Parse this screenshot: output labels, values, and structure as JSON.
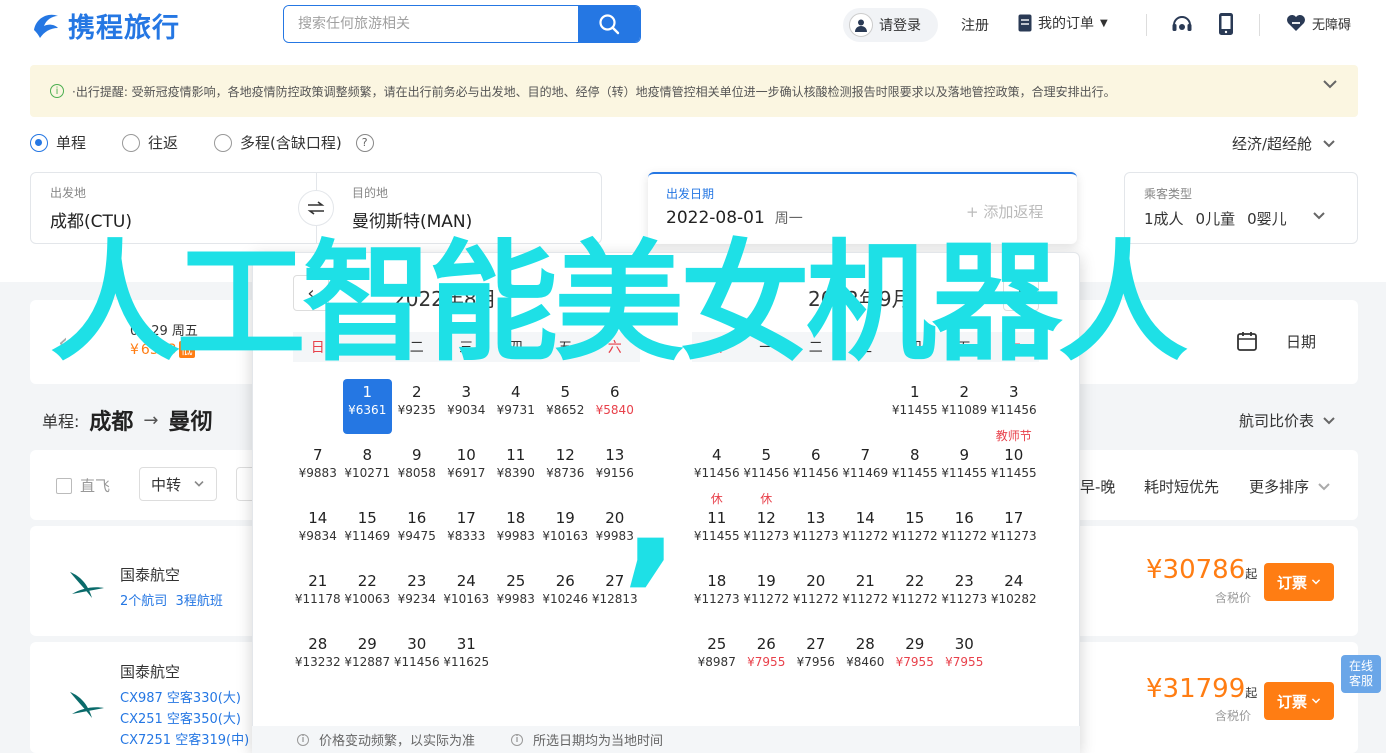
{
  "header": {
    "logo_text": "携程旅行",
    "search_placeholder": "搜索任何旅游相关",
    "login_label": "请登录",
    "register_label": "注册",
    "orders_label": "我的订单",
    "accessibility_label": "无障碍"
  },
  "notice": {
    "text": "·出行提醒: 受新冠疫情影响，各地疫情防控政策调整频繁，请在出行前务必与出发地、目的地、经停（转）地疫情管控相关单位进一步确认核酸检测报告时限要求以及落地管控政策，合理安排出行。"
  },
  "trip_types": [
    "单程",
    "往返",
    "多程(含缺口程)"
  ],
  "cabin_class": "经济/超经舱",
  "search_form": {
    "origin_label": "出发地",
    "origin_value": "成都(CTU)",
    "dest_label": "目的地",
    "dest_value": "曼彻斯特(MAN)",
    "date_label": "出发日期",
    "date_value": "2022-08-01",
    "date_weekday": "周一",
    "add_return": "+ 添加返程",
    "pax_label": "乘客类型",
    "pax_adult": "1成人",
    "pax_child": "0儿童",
    "pax_infant": "0婴儿"
  },
  "behind": {
    "date_strip_date": "07-29 周五",
    "date_strip_price": "6543",
    "date_strip_low": "低",
    "right_label": "日期",
    "route_prefix": "单程:",
    "route_from": "成都",
    "route_to": "曼彻",
    "compare_label": "航司比价表",
    "filter_direct": "直飞",
    "filter_transfer": "中转",
    "sort_early_late": "早-晚",
    "sort_shortest": "耗时短优先",
    "sort_more": "更多排序"
  },
  "flights": [
    {
      "airline": "国泰航空",
      "details": [
        "2个航司",
        "3程航班"
      ],
      "price": "¥30786",
      "price_suffix": "起",
      "tax_note": "含税价",
      "order_label": "订票"
    },
    {
      "airline": "国泰航空",
      "details": [
        "CX987 空客330(大)",
        "CX251 空客350(大)",
        "CX7251 空客319(中)"
      ],
      "price": "¥31799",
      "price_suffix": "起",
      "tax_note": "含税价",
      "order_label": "订票"
    }
  ],
  "calendar": {
    "left_title": "2022年8月",
    "right_title": "2022年9月",
    "weekdays": [
      "日",
      "一",
      "二",
      "三",
      "四",
      "五",
      "六"
    ],
    "left_days": [
      {
        "d": "1",
        "p": "¥6361",
        "sel": true
      },
      {
        "d": "2",
        "p": "¥9235"
      },
      {
        "d": "3",
        "p": "¥9034"
      },
      {
        "d": "4",
        "p": "¥9731"
      },
      {
        "d": "5",
        "p": "¥8652"
      },
      {
        "d": "6",
        "p": "¥5840",
        "red": true
      },
      {
        "d": "7",
        "p": "¥9883"
      },
      {
        "d": "8",
        "p": "¥10271"
      },
      {
        "d": "9",
        "p": "¥8058"
      },
      {
        "d": "10",
        "p": "¥6917"
      },
      {
        "d": "11",
        "p": "¥8390"
      },
      {
        "d": "12",
        "p": "¥8736"
      },
      {
        "d": "13",
        "p": "¥9156"
      },
      {
        "d": "14",
        "p": "¥9834"
      },
      {
        "d": "15",
        "p": "¥11469"
      },
      {
        "d": "16",
        "p": "¥9475"
      },
      {
        "d": "17",
        "p": "¥8333"
      },
      {
        "d": "18",
        "p": "¥9983"
      },
      {
        "d": "19",
        "p": "¥10163"
      },
      {
        "d": "20",
        "p": "¥9983"
      },
      {
        "d": "21",
        "p": "¥11178"
      },
      {
        "d": "22",
        "p": "¥10063"
      },
      {
        "d": "23",
        "p": "¥9234"
      },
      {
        "d": "24",
        "p": "¥10163"
      },
      {
        "d": "25",
        "p": "¥9983"
      },
      {
        "d": "26",
        "p": "¥10246"
      },
      {
        "d": "27",
        "p": "¥12813"
      },
      {
        "d": "28",
        "p": "¥13232"
      },
      {
        "d": "29",
        "p": "¥12887"
      },
      {
        "d": "30",
        "p": "¥11456"
      },
      {
        "d": "31",
        "p": "¥11625"
      }
    ],
    "right_days": [
      {
        "d": "1",
        "p": "¥11455"
      },
      {
        "d": "2",
        "p": "¥11089"
      },
      {
        "d": "3",
        "p": "¥11456"
      },
      {
        "d": "4",
        "p": "¥11456"
      },
      {
        "d": "5",
        "p": "¥11456"
      },
      {
        "d": "6",
        "p": "¥11456"
      },
      {
        "d": "7",
        "p": "¥11469"
      },
      {
        "d": "8",
        "p": "¥11455"
      },
      {
        "d": "9",
        "p": "¥11455"
      },
      {
        "d": "10",
        "p": "¥11455",
        "tag": "教师节"
      },
      {
        "d": "11",
        "p": "¥11455",
        "tag": "休"
      },
      {
        "d": "12",
        "p": "¥11273",
        "tag": "休"
      },
      {
        "d": "13",
        "p": "¥11273"
      },
      {
        "d": "14",
        "p": "¥11272"
      },
      {
        "d": "15",
        "p": "¥11272"
      },
      {
        "d": "16",
        "p": "¥11272"
      },
      {
        "d": "17",
        "p": "¥11273"
      },
      {
        "d": "18",
        "p": "¥11273"
      },
      {
        "d": "19",
        "p": "¥11272"
      },
      {
        "d": "20",
        "p": "¥11272"
      },
      {
        "d": "21",
        "p": "¥11272"
      },
      {
        "d": "22",
        "p": "¥11272"
      },
      {
        "d": "23",
        "p": "¥11273"
      },
      {
        "d": "24",
        "p": "¥10282"
      },
      {
        "d": "25",
        "p": "¥8987"
      },
      {
        "d": "26",
        "p": "¥7955",
        "red": true
      },
      {
        "d": "27",
        "p": "¥7956"
      },
      {
        "d": "28",
        "p": "¥8460"
      },
      {
        "d": "29",
        "p": "¥7955",
        "red": true
      },
      {
        "d": "30",
        "p": "¥7955",
        "red": true
      }
    ],
    "footer_note1": "价格变动频繁，以实际为准",
    "footer_note2": "所选日期均为当地时间"
  },
  "overlay": {
    "text": "人工智能美女机器人",
    "comma": ","
  },
  "side_widget": {
    "line1": "在线",
    "line2": "客服"
  },
  "colors": {
    "brand": "#2577e3",
    "orange": "#ff7d13",
    "overlay": "#1ee0e6",
    "red": "#e8414b"
  }
}
